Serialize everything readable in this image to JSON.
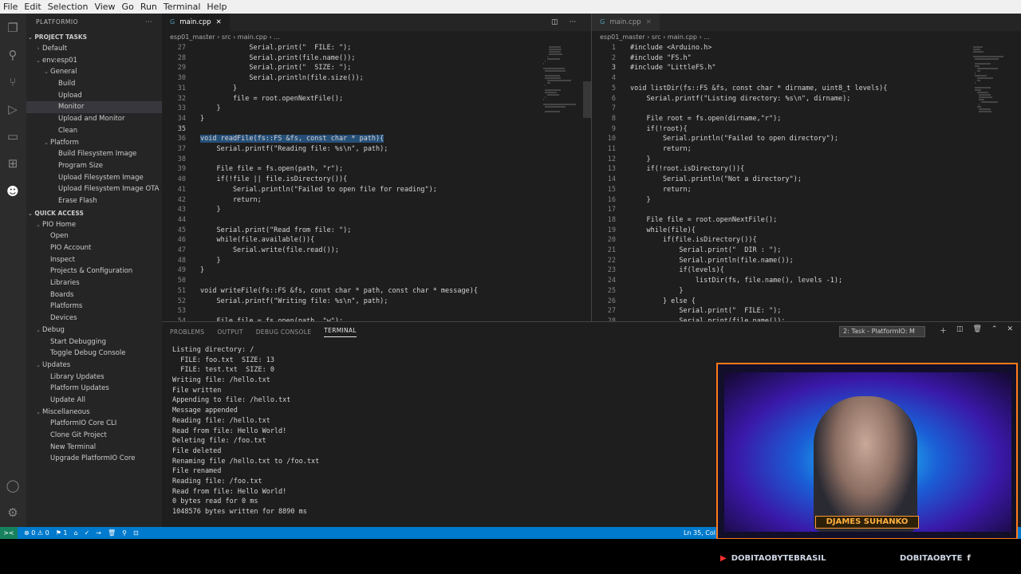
{
  "menu": [
    "File",
    "Edit",
    "Selection",
    "View",
    "Go",
    "Run",
    "Terminal",
    "Help"
  ],
  "activity_icons": [
    "files-icon",
    "search-icon",
    "source-control-icon",
    "run-debug-icon",
    "remote-explorer-icon",
    "extensions-icon",
    "platformio-icon",
    "account-icon",
    "settings-gear-icon"
  ],
  "sidebar": {
    "title": "PLATFORMIO",
    "more": "···",
    "project_tasks_header": "PROJECT TASKS",
    "project_tasks": [
      {
        "label": "Default",
        "indent": 1,
        "chev": "›"
      },
      {
        "label": "env:esp01",
        "indent": 1,
        "chev": "⌄"
      },
      {
        "label": "General",
        "indent": 2,
        "chev": "⌄"
      },
      {
        "label": "Build",
        "indent": 3,
        "chev": ""
      },
      {
        "label": "Upload",
        "indent": 3,
        "chev": ""
      },
      {
        "label": "Monitor",
        "indent": 3,
        "chev": "",
        "selected": true
      },
      {
        "label": "Upload and Monitor",
        "indent": 3,
        "chev": ""
      },
      {
        "label": "Clean",
        "indent": 3,
        "chev": ""
      },
      {
        "label": "Platform",
        "indent": 2,
        "chev": "⌄"
      },
      {
        "label": "Build Filesystem Image",
        "indent": 3,
        "chev": ""
      },
      {
        "label": "Program Size",
        "indent": 3,
        "chev": ""
      },
      {
        "label": "Upload Filesystem Image",
        "indent": 3,
        "chev": ""
      },
      {
        "label": "Upload Filesystem Image OTA",
        "indent": 3,
        "chev": ""
      },
      {
        "label": "Erase Flash",
        "indent": 3,
        "chev": ""
      }
    ],
    "quick_access_header": "QUICK ACCESS",
    "quick_access": [
      {
        "label": "PIO Home",
        "indent": 1,
        "chev": "⌄"
      },
      {
        "label": "Open",
        "indent": 2,
        "chev": ""
      },
      {
        "label": "PIO Account",
        "indent": 2,
        "chev": ""
      },
      {
        "label": "Inspect",
        "indent": 2,
        "chev": ""
      },
      {
        "label": "Projects & Configuration",
        "indent": 2,
        "chev": ""
      },
      {
        "label": "Libraries",
        "indent": 2,
        "chev": ""
      },
      {
        "label": "Boards",
        "indent": 2,
        "chev": ""
      },
      {
        "label": "Platforms",
        "indent": 2,
        "chev": ""
      },
      {
        "label": "Devices",
        "indent": 2,
        "chev": ""
      },
      {
        "label": "Debug",
        "indent": 1,
        "chev": "⌄"
      },
      {
        "label": "Start Debugging",
        "indent": 2,
        "chev": ""
      },
      {
        "label": "Toggle Debug Console",
        "indent": 2,
        "chev": ""
      },
      {
        "label": "Updates",
        "indent": 1,
        "chev": "⌄"
      },
      {
        "label": "Library Updates",
        "indent": 2,
        "chev": ""
      },
      {
        "label": "Platform Updates",
        "indent": 2,
        "chev": ""
      },
      {
        "label": "Update All",
        "indent": 2,
        "chev": ""
      },
      {
        "label": "Miscellaneous",
        "indent": 1,
        "chev": "⌄"
      },
      {
        "label": "PlatformIO Core CLI",
        "indent": 2,
        "chev": ""
      },
      {
        "label": "Clone Git Project",
        "indent": 2,
        "chev": ""
      },
      {
        "label": "New Terminal",
        "indent": 2,
        "chev": ""
      },
      {
        "label": "Upgrade PlatformIO Core",
        "indent": 2,
        "chev": ""
      }
    ]
  },
  "left_editor": {
    "tab": "main.cpp",
    "breadcrumb": "esp01_master › src › main.cpp › ...",
    "lines": [
      {
        "n": "27",
        "t": "            Serial.print(\"  FILE: \");"
      },
      {
        "n": "28",
        "t": "            Serial.print(file.name());"
      },
      {
        "n": "29",
        "t": "            Serial.print(\"  SIZE: \");"
      },
      {
        "n": "30",
        "t": "            Serial.println(file.size());"
      },
      {
        "n": "31",
        "t": "        }"
      },
      {
        "n": "32",
        "t": "        file = root.openNextFile();"
      },
      {
        "n": "33",
        "t": "    }"
      },
      {
        "n": "34",
        "t": "}"
      },
      {
        "n": "35",
        "t": ""
      },
      {
        "n": "36",
        "t": "void readFile(fs::FS &fs, const char * path){"
      },
      {
        "n": "37",
        "t": "    Serial.printf(\"Reading file: %s\\n\", path);"
      },
      {
        "n": "38",
        "t": ""
      },
      {
        "n": "39",
        "t": "    File file = fs.open(path, \"r\");"
      },
      {
        "n": "40",
        "t": "    if(!file || file.isDirectory()){"
      },
      {
        "n": "41",
        "t": "        Serial.println(\"Failed to open file for reading\");"
      },
      {
        "n": "42",
        "t": "        return;"
      },
      {
        "n": "43",
        "t": "    }"
      },
      {
        "n": "44",
        "t": ""
      },
      {
        "n": "45",
        "t": "    Serial.print(\"Read from file: \");"
      },
      {
        "n": "46",
        "t": "    while(file.available()){"
      },
      {
        "n": "47",
        "t": "        Serial.write(file.read());"
      },
      {
        "n": "48",
        "t": "    }"
      },
      {
        "n": "49",
        "t": "}"
      },
      {
        "n": "50",
        "t": ""
      },
      {
        "n": "51",
        "t": "void writeFile(fs::FS &fs, const char * path, const char * message){"
      },
      {
        "n": "52",
        "t": "    Serial.printf(\"Writing file: %s\\n\", path);"
      },
      {
        "n": "53",
        "t": ""
      },
      {
        "n": "54",
        "t": "    File file = fs.open(path, \"w\");"
      }
    ]
  },
  "right_editor": {
    "tab": "main.cpp",
    "breadcrumb": "esp01_master › src › main.cpp › ...",
    "lines": [
      {
        "n": "1",
        "t": "#include <Arduino.h>"
      },
      {
        "n": "2",
        "t": "#include \"FS.h\""
      },
      {
        "n": "3",
        "t": "#include \"LittleFS.h\""
      },
      {
        "n": "4",
        "t": ""
      },
      {
        "n": "5",
        "t": "void listDir(fs::FS &fs, const char * dirname, uint8_t levels){"
      },
      {
        "n": "6",
        "t": "    Serial.printf(\"Listing directory: %s\\n\", dirname);"
      },
      {
        "n": "7",
        "t": ""
      },
      {
        "n": "8",
        "t": "    File root = fs.open(dirname,\"r\");"
      },
      {
        "n": "9",
        "t": "    if(!root){"
      },
      {
        "n": "10",
        "t": "        Serial.println(\"Failed to open directory\");"
      },
      {
        "n": "11",
        "t": "        return;"
      },
      {
        "n": "12",
        "t": "    }"
      },
      {
        "n": "13",
        "t": "    if(!root.isDirectory()){"
      },
      {
        "n": "14",
        "t": "        Serial.println(\"Not a directory\");"
      },
      {
        "n": "15",
        "t": "        return;"
      },
      {
        "n": "16",
        "t": "    }"
      },
      {
        "n": "17",
        "t": ""
      },
      {
        "n": "18",
        "t": "    File file = root.openNextFile();"
      },
      {
        "n": "19",
        "t": "    while(file){"
      },
      {
        "n": "20",
        "t": "        if(file.isDirectory()){"
      },
      {
        "n": "21",
        "t": "            Serial.print(\"  DIR : \");"
      },
      {
        "n": "22",
        "t": "            Serial.println(file.name());"
      },
      {
        "n": "23",
        "t": "            if(levels){"
      },
      {
        "n": "24",
        "t": "                listDir(fs, file.name(), levels -1);"
      },
      {
        "n": "25",
        "t": "            }"
      },
      {
        "n": "26",
        "t": "        } else {"
      },
      {
        "n": "27",
        "t": "            Serial.print(\"  FILE: \");"
      },
      {
        "n": "28",
        "t": "            Serial.print(file.name());"
      }
    ]
  },
  "panel": {
    "tabs": [
      "PROBLEMS",
      "OUTPUT",
      "DEBUG CONSOLE",
      "TERMINAL"
    ],
    "active_tab": "TERMINAL",
    "terminal_select": "2: Task - PlatformIO: M",
    "terminal_lines": [
      "Listing directory: /",
      "  FILE: foo.txt  SIZE: 13",
      "  FILE: test.txt  SIZE: 0",
      "Writing file: /hello.txt",
      "File written",
      "Appending to file: /hello.txt",
      "Message appended",
      "Reading file: /hello.txt",
      "Read from file: Hello World!",
      "Deleting file: /foo.txt",
      "File deleted",
      "Renaming file /hello.txt to /foo.txt",
      "File renamed",
      "Reading file: /foo.txt",
      "Read from file: Hello World!",
      "0 bytes read for 0 ms",
      "1048576 bytes written for 8890 ms"
    ]
  },
  "statusbar": {
    "remote": "><",
    "problems": "⊗ 0 ⚠ 0",
    "sync": "⚑ 1",
    "items": [
      "⌂",
      "✓",
      "→",
      "🗑",
      "⚲",
      "⊡"
    ],
    "position": "Ln 35, Col"
  },
  "webcam": {
    "name": "DJAMES SUHANKO"
  },
  "social": {
    "left": "DOBITAOBYTEBRASIL",
    "right": "DOBITAOBYTE"
  },
  "colors": {
    "statusbar": "#007acc",
    "activitybar": "#2c2c2c",
    "sidebar": "#252526",
    "editor": "#1e1e1e",
    "webcam_border": "#ff7b1c"
  }
}
